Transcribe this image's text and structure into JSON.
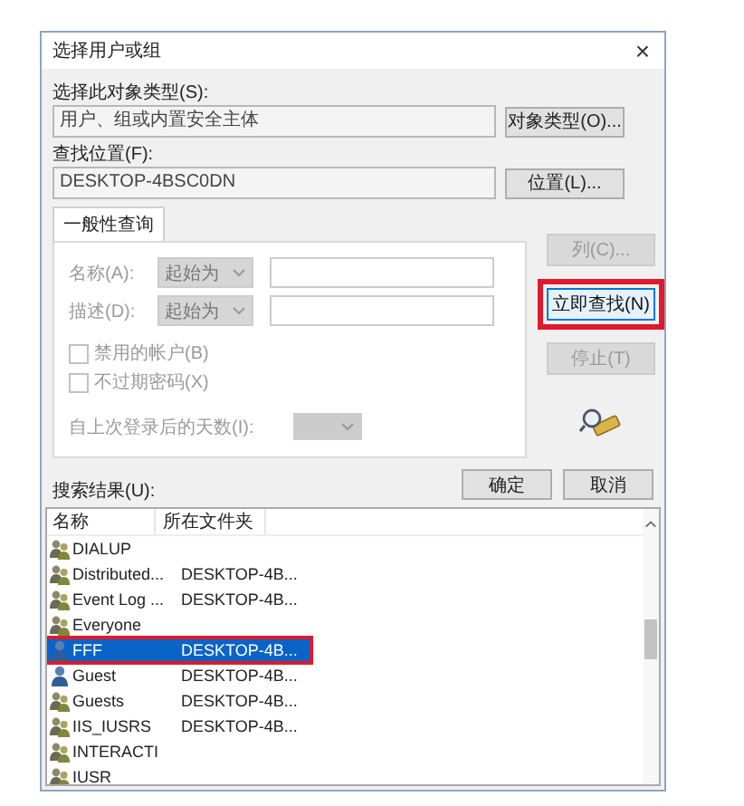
{
  "window": {
    "title": "选择用户或组",
    "close": "×"
  },
  "object_type": {
    "label": "选择此对象类型(S):",
    "value": "用户、组或内置安全主体",
    "button": "对象类型(O)..."
  },
  "location": {
    "label": "查找位置(F):",
    "value": "DESKTOP-4BSC0DN",
    "button": "位置(L)..."
  },
  "tabs": [
    {
      "label": "一般性查询",
      "selected": true
    }
  ],
  "query": {
    "rows": [
      {
        "label": "名称(A):",
        "mode": "起始为",
        "disabled": true
      },
      {
        "label": "描述(D):",
        "mode": "起始为",
        "disabled": true
      }
    ],
    "checkboxes": [
      {
        "label": "禁用的帐户(B)",
        "checked": false,
        "disabled": true
      },
      {
        "label": "不过期密码(X)",
        "checked": false,
        "disabled": true
      }
    ],
    "days_label": "自上次登录后的天数(I):"
  },
  "side_buttons": [
    {
      "label": "列(C)...",
      "disabled": true,
      "highlighted": false
    },
    {
      "label": "立即查找(N)",
      "disabled": false,
      "highlighted": true
    },
    {
      "label": "停止(T)",
      "disabled": true,
      "highlighted": false
    }
  ],
  "buttons": [
    "确定",
    "取消"
  ],
  "results": {
    "label": "搜索结果(U):",
    "columns": [
      "名称",
      "所在文件夹"
    ],
    "rows": [
      {
        "name": "DIALUP",
        "folder": "",
        "kind": "group",
        "selected": false,
        "highlighted": false
      },
      {
        "name": "Distributed...",
        "folder": "DESKTOP-4B...",
        "kind": "group",
        "selected": false,
        "highlighted": false
      },
      {
        "name": "Event Log ...",
        "folder": "DESKTOP-4B...",
        "kind": "group",
        "selected": false,
        "highlighted": false
      },
      {
        "name": "Everyone",
        "folder": "",
        "kind": "group",
        "selected": false,
        "highlighted": false
      },
      {
        "name": "FFF",
        "folder": "DESKTOP-4B...",
        "kind": "user",
        "selected": true,
        "highlighted": true
      },
      {
        "name": "Guest",
        "folder": "DESKTOP-4B...",
        "kind": "user",
        "selected": false,
        "highlighted": false
      },
      {
        "name": "Guests",
        "folder": "DESKTOP-4B...",
        "kind": "group",
        "selected": false,
        "highlighted": false
      },
      {
        "name": "IIS_IUSRS",
        "folder": "DESKTOP-4B...",
        "kind": "group",
        "selected": false,
        "highlighted": false
      },
      {
        "name": "INTERACTI",
        "folder": "",
        "kind": "group",
        "selected": false,
        "highlighted": false
      },
      {
        "name": "IUSR",
        "folder": "",
        "kind": "group",
        "selected": false,
        "highlighted": false
      }
    ]
  }
}
